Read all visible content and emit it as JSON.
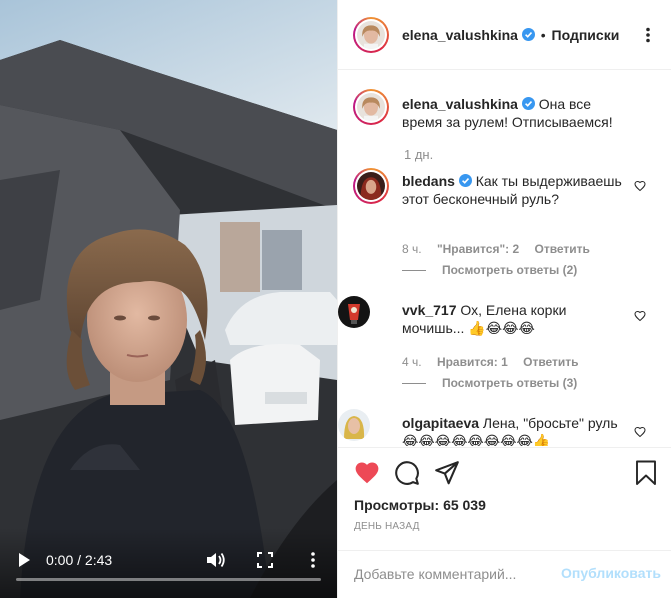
{
  "video": {
    "time": "0:00 / 2:43",
    "progress_fraction": 0.0
  },
  "header": {
    "username": "elena_valushkina",
    "separator": "•",
    "follow_label": "Подписки"
  },
  "caption": {
    "username": "elena_valushkina",
    "text": "Она все время за рулем! Отписываемся!",
    "time": "1 дн."
  },
  "comments": [
    {
      "username": "bledans",
      "verified": true,
      "text": "Как ты выдерживаешь этот бесконечный руль?",
      "time": "8 ч.",
      "likes": "\"Нравится\": 2",
      "reply": "Ответить",
      "view_replies": "Посмотреть ответы (2)"
    },
    {
      "username": "vvk_717",
      "verified": false,
      "text": "Ох, Елена корки мочишь... 👍😂😂😂",
      "time": "4 ч.",
      "likes": "Нравится: 1",
      "reply": "Ответить",
      "view_replies": "Посмотреть ответы (3)"
    },
    {
      "username": "olgapitaeva",
      "verified": false,
      "text": "Лена, \"бросьте\" руль😂😂😂😂😂😂😂😂👍",
      "time": "",
      "likes": "",
      "reply": "",
      "view_replies": ""
    }
  ],
  "stats": {
    "views_label": "Просмотры:",
    "views_value": "65 039",
    "date": "ДЕНЬ НАЗАД"
  },
  "add_comment": {
    "placeholder": "Добавьте комментарий...",
    "publish_label": "Опубликовать"
  },
  "colors": {
    "like_red": "#ed4956",
    "verified_blue": "#3897f0",
    "publish_disabled": "#b2dffc",
    "meta_gray": "#8e8e8e",
    "border": "#efefef"
  },
  "icons": [
    "play-icon",
    "volume-icon",
    "fullscreen-icon",
    "more-vertical-icon",
    "verified-badge-icon",
    "more-horizontal-icon",
    "heart-outline-icon",
    "heart-filled-icon",
    "comment-icon",
    "share-icon",
    "bookmark-icon"
  ]
}
